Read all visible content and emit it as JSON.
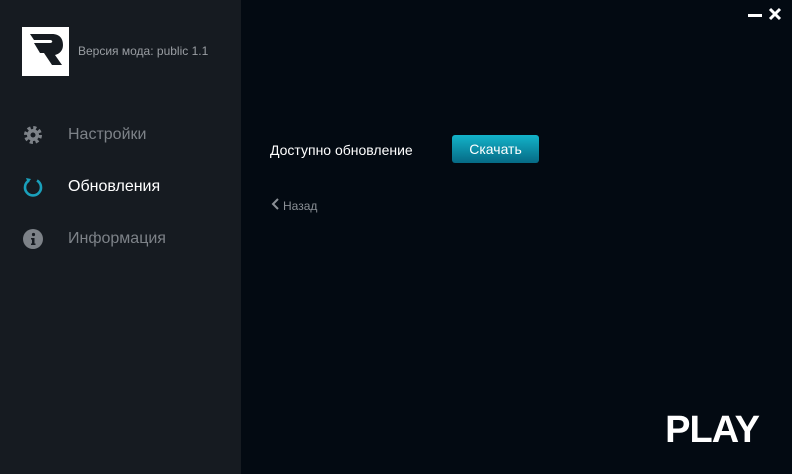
{
  "sidebar": {
    "version_text": "Версия мода: public 1.1",
    "items": [
      {
        "label": "Настройки",
        "icon": "gear-icon"
      },
      {
        "label": "Обновления",
        "icon": "refresh-icon",
        "active": true
      },
      {
        "label": "Информация",
        "icon": "info-icon"
      }
    ]
  },
  "main": {
    "update_text": "Доступно обновление",
    "download_label": "Скачать",
    "back_label": "Назад",
    "play_label": "PLAY"
  },
  "colors": {
    "accent": "#1aa0bb",
    "sidebar": "#161b21",
    "background": "#030a12"
  }
}
